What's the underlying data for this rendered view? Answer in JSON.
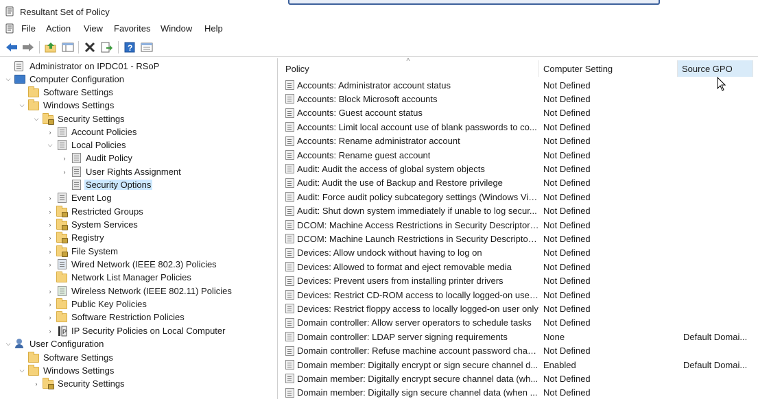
{
  "window": {
    "title": "Resultant Set of Policy"
  },
  "menu": [
    "File",
    "Action",
    "View",
    "Favorites",
    "Window",
    "Help"
  ],
  "toolbar": {
    "buttons": [
      "back-icon",
      "forward-icon",
      "up-folder-icon",
      "show-hide-tree-icon",
      "delete-icon",
      "export-list-icon",
      "help-icon",
      "properties-icon"
    ]
  },
  "tree": {
    "items": [
      {
        "label": "Administrator on IPDC01 - RSoP",
        "icon": "rsop-icon"
      },
      {
        "label": "Computer Configuration",
        "icon": "computer-icon"
      },
      {
        "label": "Software Settings",
        "icon": "folder-icon"
      },
      {
        "label": "Windows Settings",
        "icon": "folder-icon"
      },
      {
        "label": "Security Settings",
        "icon": "security-settings-icon"
      },
      {
        "label": "Account Policies",
        "icon": "policy-icon"
      },
      {
        "label": "Local Policies",
        "icon": "policy-icon"
      },
      {
        "label": "Audit Policy",
        "icon": "policy-icon"
      },
      {
        "label": "User Rights Assignment",
        "icon": "policy-icon"
      },
      {
        "label": "Security Options",
        "icon": "policy-icon"
      },
      {
        "label": "Event Log",
        "icon": "policy-icon"
      },
      {
        "label": "Restricted Groups",
        "icon": "locked-folder-icon"
      },
      {
        "label": "System Services",
        "icon": "locked-folder-icon"
      },
      {
        "label": "Registry",
        "icon": "locked-folder-icon"
      },
      {
        "label": "File System",
        "icon": "locked-folder-icon"
      },
      {
        "label": "Wired Network (IEEE 802.3) Policies",
        "icon": "wired-network-icon"
      },
      {
        "label": "Network List Manager Policies",
        "icon": "folder-icon"
      },
      {
        "label": "Wireless Network (IEEE 802.11) Policies",
        "icon": "wireless-network-icon"
      },
      {
        "label": "Public Key Policies",
        "icon": "folder-icon"
      },
      {
        "label": "Software Restriction Policies",
        "icon": "folder-icon"
      },
      {
        "label": "IP Security Policies on Local Computer",
        "icon": "ip-security-icon"
      },
      {
        "label": "User Configuration",
        "icon": "user-icon"
      },
      {
        "label": "Software Settings",
        "icon": "folder-icon"
      },
      {
        "label": "Windows Settings",
        "icon": "folder-icon"
      },
      {
        "label": "Security Settings",
        "icon": "security-settings-icon"
      }
    ]
  },
  "list": {
    "columns": [
      "Policy",
      "Computer Setting",
      "Source GPO"
    ],
    "rows": [
      {
        "policy": "Accounts: Administrator account status",
        "setting": "Not Defined",
        "source": ""
      },
      {
        "policy": "Accounts: Block Microsoft accounts",
        "setting": "Not Defined",
        "source": ""
      },
      {
        "policy": "Accounts: Guest account status",
        "setting": "Not Defined",
        "source": ""
      },
      {
        "policy": "Accounts: Limit local account use of blank passwords to co...",
        "setting": "Not Defined",
        "source": ""
      },
      {
        "policy": "Accounts: Rename administrator account",
        "setting": "Not Defined",
        "source": ""
      },
      {
        "policy": "Accounts: Rename guest account",
        "setting": "Not Defined",
        "source": ""
      },
      {
        "policy": "Audit: Audit the access of global system objects",
        "setting": "Not Defined",
        "source": ""
      },
      {
        "policy": "Audit: Audit the use of Backup and Restore privilege",
        "setting": "Not Defined",
        "source": ""
      },
      {
        "policy": "Audit: Force audit policy subcategory settings (Windows Vis...",
        "setting": "Not Defined",
        "source": ""
      },
      {
        "policy": "Audit: Shut down system immediately if unable to log secur...",
        "setting": "Not Defined",
        "source": ""
      },
      {
        "policy": "DCOM: Machine Access Restrictions in Security Descriptor D...",
        "setting": "Not Defined",
        "source": ""
      },
      {
        "policy": "DCOM: Machine Launch Restrictions in Security Descriptor ...",
        "setting": "Not Defined",
        "source": ""
      },
      {
        "policy": "Devices: Allow undock without having to log on",
        "setting": "Not Defined",
        "source": ""
      },
      {
        "policy": "Devices: Allowed to format and eject removable media",
        "setting": "Not Defined",
        "source": ""
      },
      {
        "policy": "Devices: Prevent users from installing printer drivers",
        "setting": "Not Defined",
        "source": ""
      },
      {
        "policy": "Devices: Restrict CD-ROM access to locally logged-on user ...",
        "setting": "Not Defined",
        "source": ""
      },
      {
        "policy": "Devices: Restrict floppy access to locally logged-on user only",
        "setting": "Not Defined",
        "source": ""
      },
      {
        "policy": "Domain controller: Allow server operators to schedule tasks",
        "setting": "Not Defined",
        "source": ""
      },
      {
        "policy": "Domain controller: LDAP server signing requirements",
        "setting": "None",
        "source": "Default Domai..."
      },
      {
        "policy": "Domain controller: Refuse machine account password chan...",
        "setting": "Not Defined",
        "source": ""
      },
      {
        "policy": "Domain member: Digitally encrypt or sign secure channel d...",
        "setting": "Enabled",
        "source": "Default Domai..."
      },
      {
        "policy": "Domain member: Digitally encrypt secure channel data (wh...",
        "setting": "Not Defined",
        "source": ""
      },
      {
        "policy": "Domain member: Digitally sign secure channel data (when ...",
        "setting": "Not Defined",
        "source": ""
      }
    ]
  }
}
